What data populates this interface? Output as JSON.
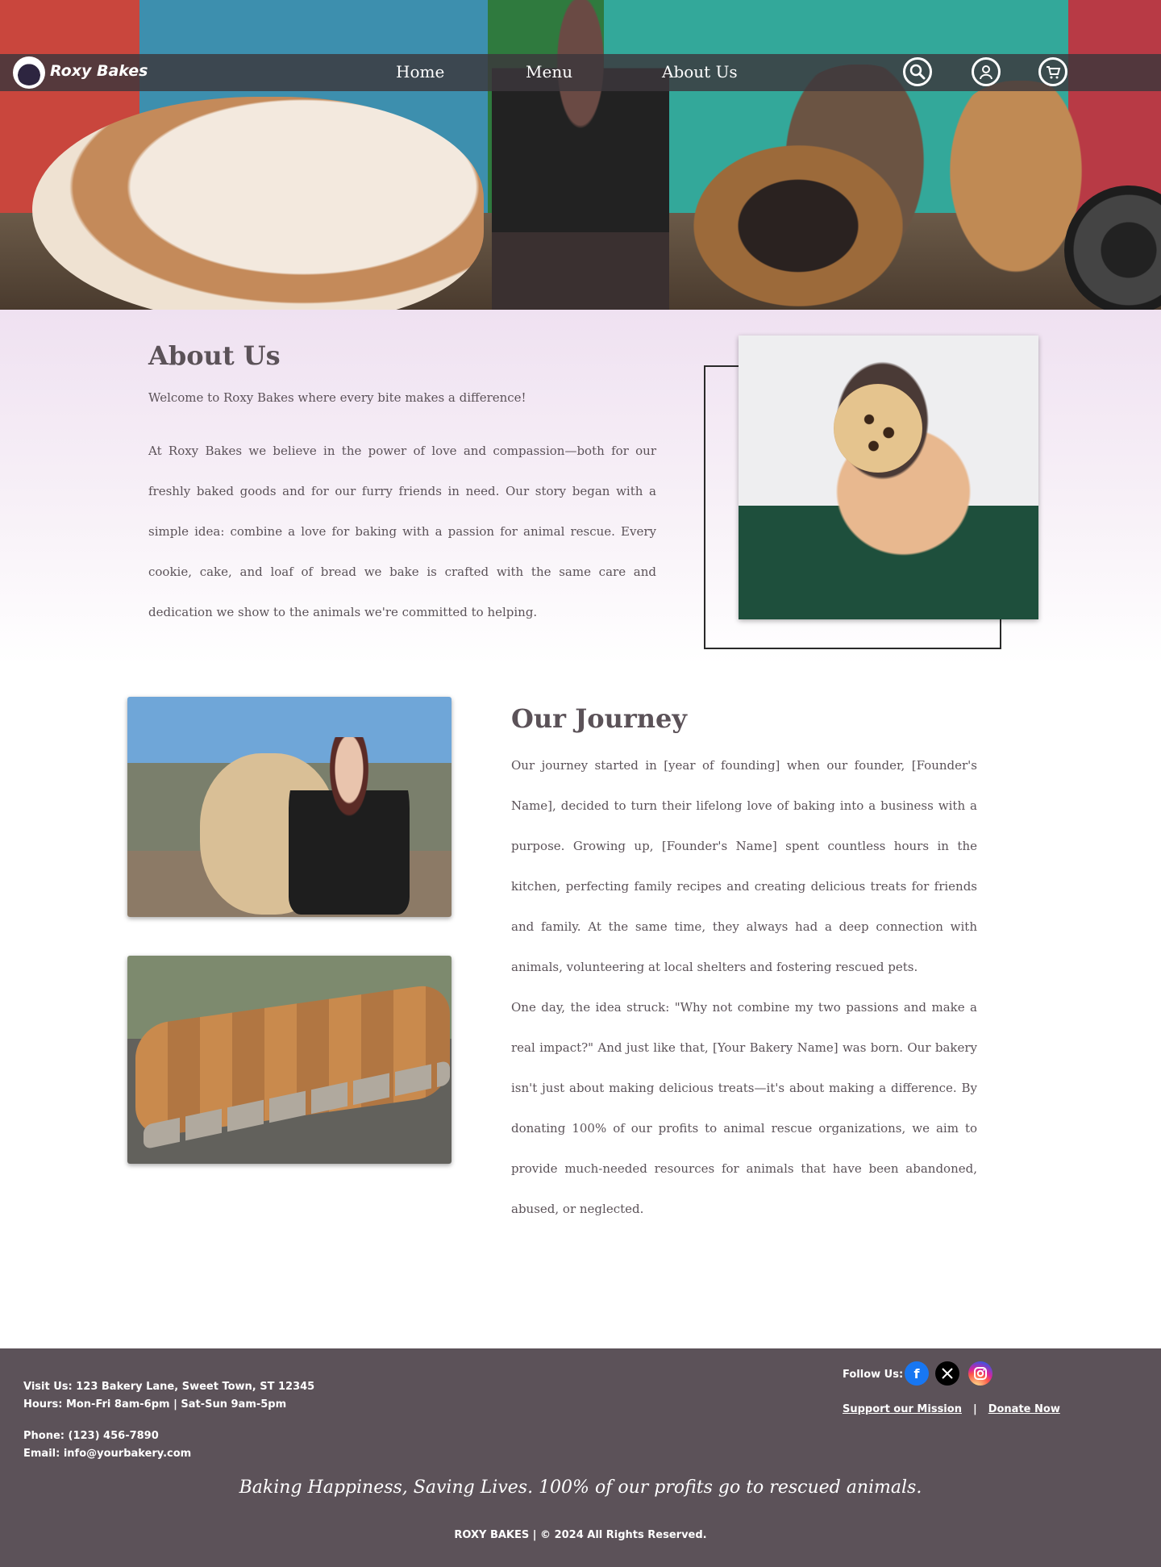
{
  "header": {
    "brand": "Roxy Bakes",
    "nav": [
      "Home",
      "Menu",
      "About Us"
    ],
    "icons": [
      "search-icon",
      "user-icon",
      "cart-icon"
    ]
  },
  "about": {
    "title": "About Us",
    "intro": "Welcome to Roxy Bakes where every bite makes a difference!",
    "body": "At Roxy Bakes we believe in the power of love and compassion—both for our freshly baked goods and for our furry friends in need. Our story began with a simple idea: combine a love for baking with a passion for animal rescue. Every cookie, cake, and loaf of bread we bake is crafted with the same care and dedication we show to the animals we're committed to helping."
  },
  "journey": {
    "title": "Our Journey",
    "p1": "Our journey started in [year of founding] when our founder, [Founder's Name], decided to turn their lifelong love of baking into a business with a purpose. Growing up, [Founder's Name] spent countless hours in the kitchen, perfecting family recipes and creating delicious treats for friends and family. At the same time, they always had a deep connection with animals, volunteering at local shelters and fostering rescued pets.",
    "p2": "One day, the idea struck: \"Why not combine my two passions and make a real impact?\" And just like that, [Your Bakery Name] was born. Our bakery isn't just about making delicious treats—it's about making a difference. By donating 100% of our profits to animal rescue organizations, we aim to provide much-needed resources for animals that have been abandoned, abused, or neglected."
  },
  "footer": {
    "address": "Visit Us: 123 Bakery Lane, Sweet Town, ST 12345",
    "hours": "Hours: Mon-Fri 8am-6pm | Sat-Sun 9am-5pm",
    "phone": "Phone: (123) 456-7890",
    "email": "Email: info@yourbakery.com",
    "follow": "Follow  Us:",
    "support": "Support our Mission",
    "separator": "|",
    "donate": "Donate Now",
    "tagline": "Baking Happiness, Saving Lives. 100% of our profits go to rescued animals.",
    "copyright": "ROXY BAKES   | © 2024 All Rights Reserved."
  }
}
